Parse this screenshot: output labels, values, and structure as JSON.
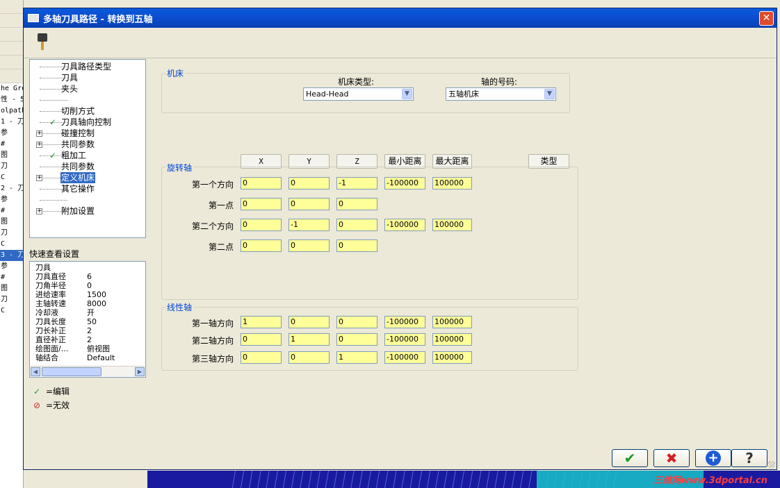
{
  "background": {
    "lines": [
      "he Gro",
      "性 - 5",
      "olpath",
      "1 - 刀",
      "参",
      "#",
      "图",
      "刀",
      "C",
      "2 - 刀",
      "参",
      "#",
      "图",
      "刀",
      "C",
      "3 - 刀",
      "参",
      "#",
      "图",
      "刀",
      "C"
    ],
    "watermark": "三维网www.3dportal.cn"
  },
  "dialog": {
    "title": "多轴刀具路径 - 转换到五轴",
    "close_label": "✕"
  },
  "tree": {
    "items": [
      {
        "label": "刀具路径类型",
        "expander": "",
        "check": ""
      },
      {
        "label": "刀具",
        "expander": "",
        "check": ""
      },
      {
        "label": "夹头",
        "expander": "",
        "check": ""
      },
      {
        "label": "",
        "expander": "",
        "check": ""
      },
      {
        "label": "切削方式",
        "expander": "",
        "check": ""
      },
      {
        "label": "刀具轴向控制",
        "expander": "",
        "check": "✓"
      },
      {
        "label": "碰撞控制",
        "expander": "+",
        "check": ""
      },
      {
        "label": "共同参数",
        "expander": "+",
        "check": ""
      },
      {
        "label": "粗加工",
        "expander": "",
        "check": "✓"
      },
      {
        "label": "共同参数",
        "expander": "",
        "check": ""
      },
      {
        "label": "定义机床",
        "expander": "+",
        "check": "",
        "selected": true
      },
      {
        "label": "其它操作",
        "expander": "",
        "check": ""
      },
      {
        "label": "",
        "expander": "",
        "check": ""
      },
      {
        "label": "附加设置",
        "expander": "+",
        "check": ""
      }
    ]
  },
  "quick_view": {
    "title": "快速查看设置",
    "header": "刀具",
    "rows": [
      {
        "key": "刀具直径",
        "value": "6"
      },
      {
        "key": "刀角半径",
        "value": "0"
      },
      {
        "key": "进给速率",
        "value": "1500"
      },
      {
        "key": "主轴转速",
        "value": "8000"
      },
      {
        "key": "冷却液",
        "value": "开"
      },
      {
        "key": "刀具长度",
        "value": "50"
      },
      {
        "key": "刀长补正",
        "value": "2"
      },
      {
        "key": "直径补正",
        "value": "2"
      },
      {
        "key": "绘图面/...",
        "value": "俯视图"
      },
      {
        "key": "轴结合",
        "value": "Default"
      }
    ]
  },
  "legend": {
    "edit": "=编辑",
    "invalid": "=无效"
  },
  "machine": {
    "group_title": "机床",
    "type_label": "机床类型:",
    "type_value": "Head-Head",
    "axis_label": "轴的号码:",
    "axis_value": "五轴机床"
  },
  "columns": {
    "x": "X",
    "y": "Y",
    "z": "Z",
    "min": "最小距离",
    "max": "最大距离",
    "type": "类型"
  },
  "rotary": {
    "group_title": "旋转轴",
    "rows": [
      {
        "label": "第一个方向",
        "x": "0",
        "y": "0",
        "z": "-1",
        "min": "-100000",
        "max": "100000"
      },
      {
        "label": "第一点",
        "x": "0",
        "y": "0",
        "z": "0"
      },
      {
        "label": "第二个方向",
        "x": "0",
        "y": "-1",
        "z": "0",
        "min": "-100000",
        "max": "100000"
      },
      {
        "label": "第二点",
        "x": "0",
        "y": "0",
        "z": "0"
      }
    ]
  },
  "linear": {
    "group_title": "线性轴",
    "rows": [
      {
        "label": "第一轴方向",
        "x": "1",
        "y": "0",
        "z": "0",
        "min": "-100000",
        "max": "100000"
      },
      {
        "label": "第二轴方向",
        "x": "0",
        "y": "1",
        "z": "0",
        "min": "-100000",
        "max": "100000"
      },
      {
        "label": "第三轴方向",
        "x": "0",
        "y": "0",
        "z": "1",
        "min": "-100000",
        "max": "100000"
      }
    ]
  },
  "buttons": {
    "ok": "✔",
    "cancel": "✖",
    "add": "+",
    "help": "?"
  },
  "colors": {
    "ok": "#1a9a1a",
    "cancel": "#d42020",
    "add": "#1e5bd6",
    "help": "#333333",
    "field_bg": "#ffff99",
    "selected_bg": "#316ac5"
  }
}
